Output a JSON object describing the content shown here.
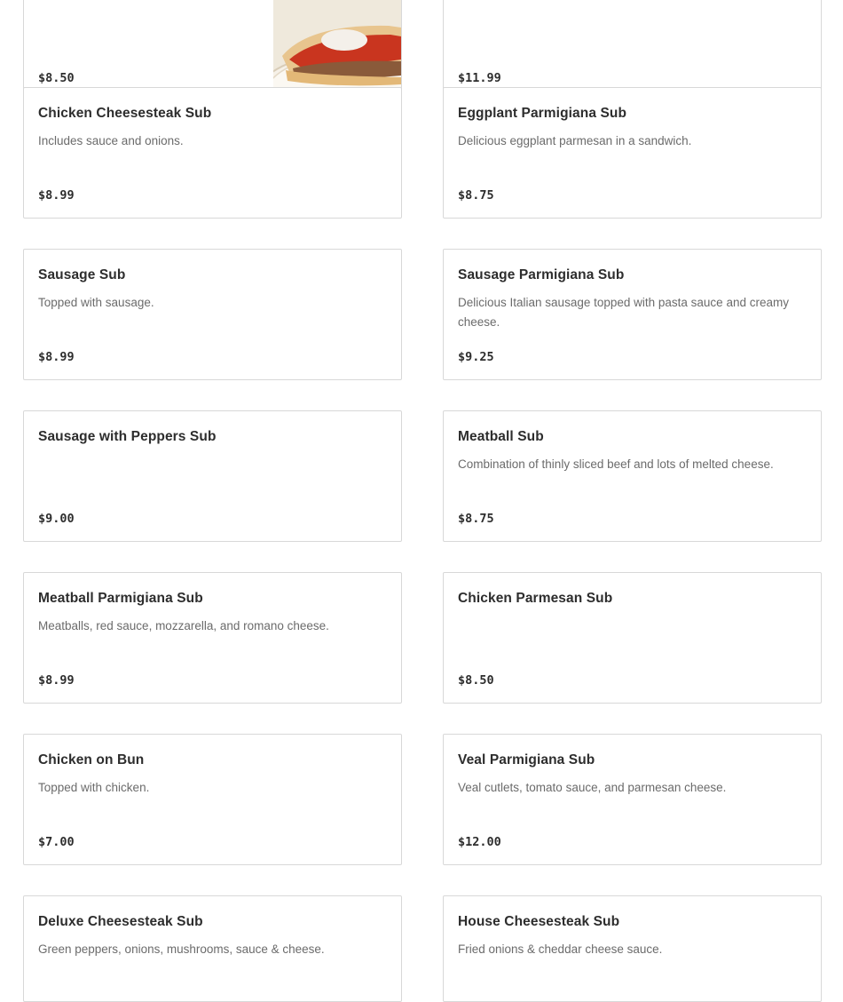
{
  "menu": {
    "items": [
      {
        "name": "",
        "description": "",
        "price": "$8.50",
        "image": "sub-photo"
      },
      {
        "name": "",
        "description": "",
        "price": "$11.99"
      },
      {
        "name": "Chicken Cheesesteak Sub",
        "description": "Includes sauce and onions.",
        "price": "$8.99"
      },
      {
        "name": "Eggplant Parmigiana Sub",
        "description": "Delicious eggplant parmesan in a sandwich.",
        "price": "$8.75"
      },
      {
        "name": "Sausage Sub",
        "description": "Topped with sausage.",
        "price": "$8.99"
      },
      {
        "name": "Sausage Parmigiana Sub",
        "description": "Delicious Italian sausage topped with pasta sauce and creamy cheese.",
        "price": "$9.25"
      },
      {
        "name": "Sausage with Peppers Sub",
        "description": "",
        "price": "$9.00"
      },
      {
        "name": "Meatball Sub",
        "description": "Combination of thinly sliced beef and lots of melted cheese.",
        "price": "$8.75"
      },
      {
        "name": "Meatball Parmigiana Sub",
        "description": "Meatballs, red sauce, mozzarella, and romano cheese.",
        "price": "$8.99"
      },
      {
        "name": "Chicken Parmesan Sub",
        "description": "",
        "price": "$8.50"
      },
      {
        "name": "Chicken on Bun",
        "description": "Topped with chicken.",
        "price": "$7.00"
      },
      {
        "name": "Veal Parmigiana Sub",
        "description": "Veal cutlets, tomato sauce, and parmesan cheese.",
        "price": "$12.00"
      },
      {
        "name": "Deluxe Cheesesteak Sub",
        "description": "Green peppers, onions, mushrooms, sauce & cheese.",
        "price": ""
      },
      {
        "name": "House Cheesesteak Sub",
        "description": "Fried onions & cheddar cheese sauce.",
        "price": ""
      }
    ]
  }
}
